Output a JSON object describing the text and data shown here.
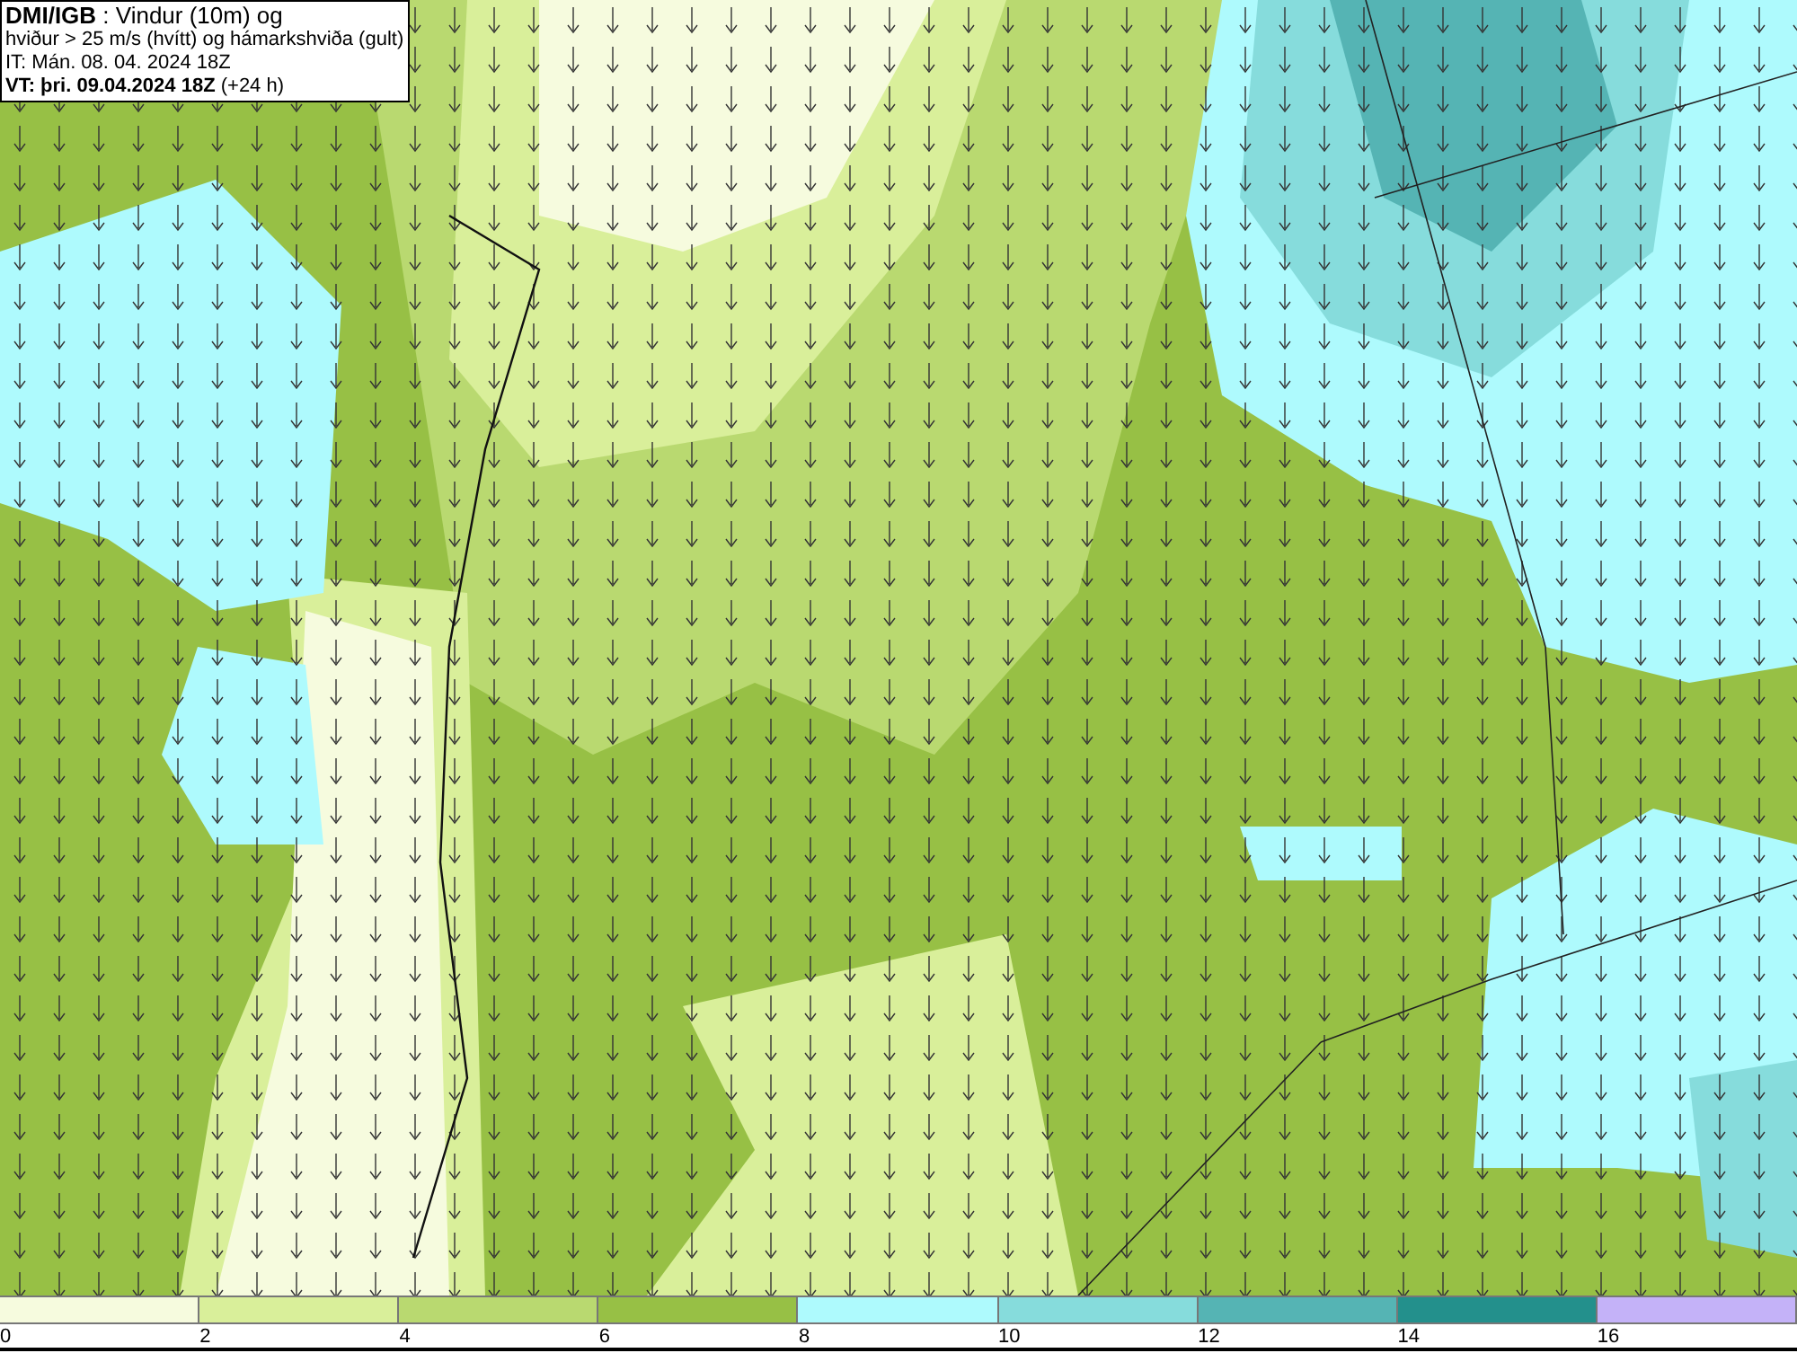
{
  "title_box": {
    "lines": [
      "**DMI/IGB** : Vindur (10m) og",
      "hviður > 25 m/s (hvítt) og hámarkshviða (gult)",
      "IT: Mán. 08. 04. 2024 18Z",
      "**VT: þri. 09.04.2024 18Z** (+24 h)"
    ]
  },
  "legend": {
    "bins": [
      {
        "label": "0",
        "color": "#f6fbde"
      },
      {
        "label": "2",
        "color": "#d9ef9a"
      },
      {
        "label": "4",
        "color": "#b9d970"
      },
      {
        "label": "6",
        "color": "#97c045"
      },
      {
        "label": "8",
        "color": "#aefafd"
      },
      {
        "label": "10",
        "color": "#86dcdc"
      },
      {
        "label": "12",
        "color": "#55b4b4"
      },
      {
        "label": "14",
        "color": "#23908c"
      },
      {
        "label": "16",
        "color": "#c4b2f8"
      }
    ]
  }
}
